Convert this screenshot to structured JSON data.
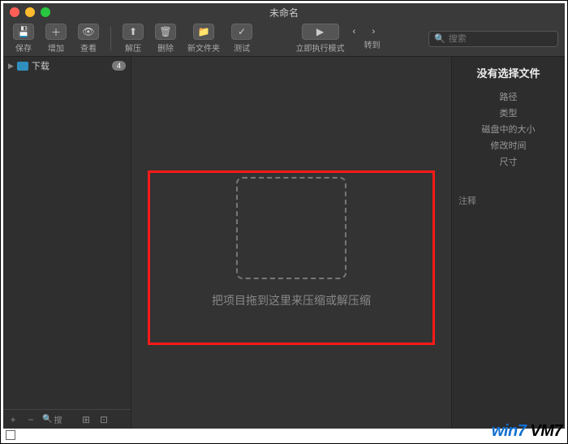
{
  "window": {
    "title": "未命名"
  },
  "toolbar": {
    "save": "保存",
    "add": "增加",
    "view": "查看",
    "extract": "解压",
    "delete": "删除",
    "new_folder": "新文件夹",
    "test": "测试",
    "run_mode": "立即执行模式",
    "goto": "转到",
    "search_placeholder": "搜索"
  },
  "sidebar": {
    "items": [
      {
        "label": "下载",
        "badge": "4"
      }
    ],
    "footer_search": "搜"
  },
  "main": {
    "drop_hint": "把项目拖到这里来压缩或解压缩"
  },
  "inspector": {
    "title": "没有选择文件",
    "rows": [
      "路径",
      "类型",
      "磁盘中的大小",
      "修改时间",
      "尺寸"
    ],
    "notes_label": "注释"
  },
  "watermark": {
    "a": "win7 ",
    "b": "VM7"
  },
  "colors": {
    "highlight": "#ff1a1a",
    "folder": "#2f8fbf"
  }
}
